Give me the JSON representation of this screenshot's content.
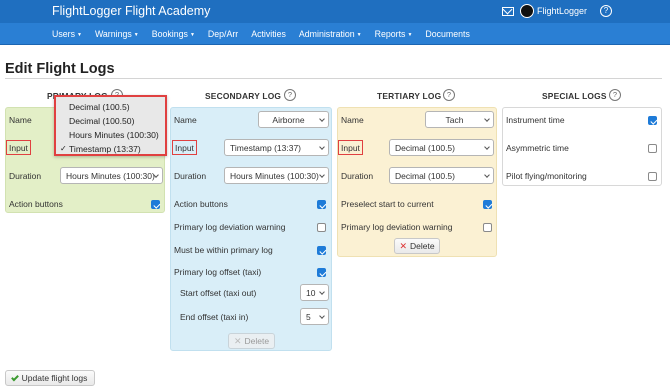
{
  "header": {
    "brand": "FlightLogger Flight Academy",
    "user_name": "FlightLogger",
    "help_icon": "?"
  },
  "nav": [
    {
      "label": "Users",
      "caret": "▼"
    },
    {
      "label": "Warnings",
      "caret": "▼"
    },
    {
      "label": "Bookings",
      "caret": "▼"
    },
    {
      "label": "Dep/Arr",
      "caret": ""
    },
    {
      "label": "Activities",
      "caret": ""
    },
    {
      "label": "Administration",
      "caret": "▼"
    },
    {
      "label": "Reports",
      "caret": "▼"
    },
    {
      "label": "Documents",
      "caret": ""
    }
  ],
  "page_title": "Edit Flight Logs",
  "primary": {
    "heading": "PRIMARY LOG",
    "name_label": "Name",
    "input_label": "Input",
    "duration_label": "Duration",
    "duration_value": "Hours Minutes (100:30)",
    "action_buttons_label": "Action buttons",
    "action_buttons_checked": true
  },
  "input_dropdown": {
    "options": [
      "Decimal (100.5)",
      "Decimal (100.50)",
      "Hours Minutes (100:30)",
      "Timestamp (13:37)"
    ],
    "selected_index": 3,
    "check_mark": "✓"
  },
  "secondary": {
    "heading": "SECONDARY LOG",
    "name_label": "Name",
    "name_value": "Airborne",
    "input_label": "Input",
    "input_value": "Timestamp (13:37)",
    "duration_label": "Duration",
    "duration_value": "Hours Minutes (100:30)",
    "action_buttons_label": "Action buttons",
    "deviation_label": "Primary log deviation warning",
    "within_label": "Must be within primary log",
    "offset_label": "Primary log offset (taxi)",
    "start_offset_label": "Start offset (taxi out)",
    "start_offset_value": "10",
    "end_offset_label": "End offset (taxi in)",
    "end_offset_value": "5",
    "delete_label": "Delete",
    "checks": {
      "action_buttons": true,
      "deviation": false,
      "within": true,
      "offset": true
    }
  },
  "tertiary": {
    "heading": "TERTIARY LOG",
    "name_label": "Name",
    "name_value": "Tach",
    "input_label": "Input",
    "input_value": "Decimal (100.5)",
    "duration_label": "Duration",
    "duration_value": "Decimal (100.5)",
    "preselect_label": "Preselect start to current",
    "deviation_label": "Primary log deviation warning",
    "delete_label": "Delete",
    "checks": {
      "preselect": true,
      "deviation": false
    }
  },
  "special": {
    "heading": "SPECIAL LOGS",
    "instrument_label": "Instrument time",
    "asymmetric_label": "Asymmetric time",
    "pilot_label": "Pilot flying/monitoring",
    "checks": {
      "instrument": true,
      "asymmetric": false,
      "pilot": false
    }
  },
  "help_q": "?",
  "delete_mark": "✕",
  "update_label": "Update flight logs",
  "colors": {
    "topbar": "#1f6fc0",
    "navbar": "#2a7fd4",
    "primary_panel": "#e3efc7",
    "secondary_panel": "#d9eef8",
    "tertiary_panel": "#fbf1d3",
    "checkbox_checked": "#1e7bd8",
    "highlight_border": "#e04040"
  }
}
